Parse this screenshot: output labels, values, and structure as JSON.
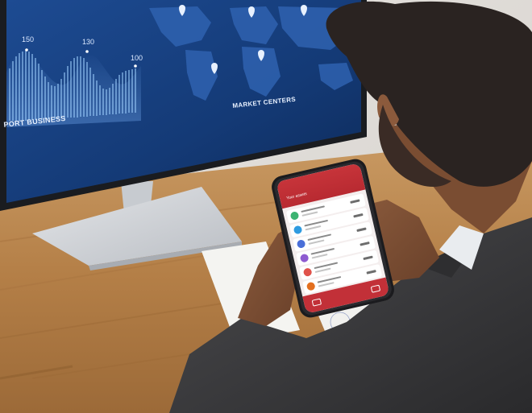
{
  "monitor": {
    "chart_peaks": [
      "150",
      "130",
      "100"
    ],
    "left_caption": "PORT BUSINESS",
    "map_caption": "MARKET CENTERS"
  },
  "phone": {
    "header_title": "Your assets",
    "rows": [
      {
        "avatar_color": "#3cb371"
      },
      {
        "avatar_color": "#2f9be0"
      },
      {
        "avatar_color": "#4a6fd8"
      },
      {
        "avatar_color": "#8e5bd0"
      },
      {
        "avatar_color": "#e0524a"
      },
      {
        "avatar_color": "#e36f1f"
      },
      {
        "avatar_color": "#c2407a"
      }
    ]
  },
  "colors": {
    "monitor_screen": "#163b78",
    "phone_accent": "#c23038",
    "desk_wood": "#b8864f"
  }
}
